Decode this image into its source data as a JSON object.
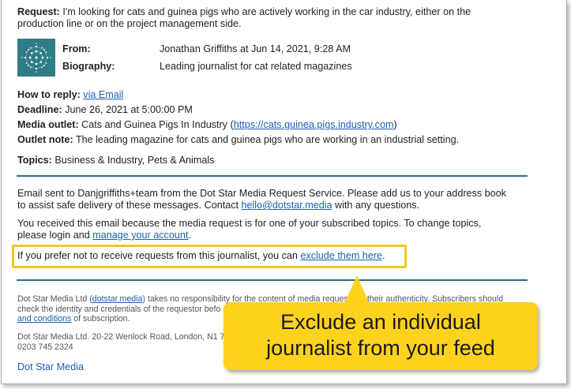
{
  "request": {
    "label": "Request:",
    "text_line1": "I'm looking for cats and guinea pigs who are actively working in the car industry, either on the",
    "text_line2": "production line or on the project management side."
  },
  "meta": {
    "from_label": "From:",
    "from_value": "Jonathan Griffiths at Jun 14, 2021, 9:28 AM",
    "bio_label": "Biography:",
    "bio_value": "Leading journalist for cat related magazines"
  },
  "details": {
    "reply_label": "How to reply:",
    "reply_link": "via Email",
    "deadline_label": "Deadline:",
    "deadline_value": "June 26, 2021 at 5:00:00 PM",
    "outlet_label": "Media outlet:",
    "outlet_value": "Cats and Guinea Pigs In Industry (",
    "outlet_url": "https://cats.guinea.pigs.industry.com",
    "outlet_close": ")",
    "note_label": "Outlet note:",
    "note_value": "The leading magazine for cats and guinea pigs who are working in an industrial setting.",
    "topics_label": "Topics:",
    "topics_value": "Business & Industry, Pets & Animals"
  },
  "notice": {
    "sent_line1": "Email sent to Danjgriffiths+team from the Dot Star Media Request Service. Please add us to your address book",
    "sent_line2_a": "to assist safe delivery of these messages. Contact ",
    "sent_email": "hello@dotstar.media",
    "sent_line2_b": " with any questions.",
    "recv_line1": "You received this email because the media request is for one of your subscribed topics. To change topics,",
    "recv_line2_a": "please login and ",
    "recv_link": "manage your account",
    "recv_line2_b": ".",
    "exclude_a": "If you prefer not to receive requests from this journalist, you can ",
    "exclude_link": "exclude them here",
    "exclude_b": "."
  },
  "footer": {
    "disc_a": "Dot Star Media Ltd (",
    "disc_link": "dotstar.media",
    "disc_b": ") takes no responsibility for the content of media reques",
    "disc_c": "r their authenticity. Subscribers should",
    "disc_line2": "check the identity and credentials of the requestor befo",
    "disc_line3_link": "and conditions",
    "disc_line3_b": " of subscription.",
    "addr_line1": "Dot Star Media Ltd. 20-22 Wenlock Road, London, N1 7",
    "addr_line2": "0203 745 2324",
    "brand_link": "Dot Star Media"
  },
  "callout": {
    "line1": "Exclude an individual",
    "line2": "journalist from your feed"
  },
  "colors": {
    "accent": "#2f6f79",
    "link": "#1a5fb4",
    "highlight": "#f3c623",
    "callout": "#ffd21e"
  },
  "icons": {
    "logo": "dotstar-logo-icon"
  }
}
